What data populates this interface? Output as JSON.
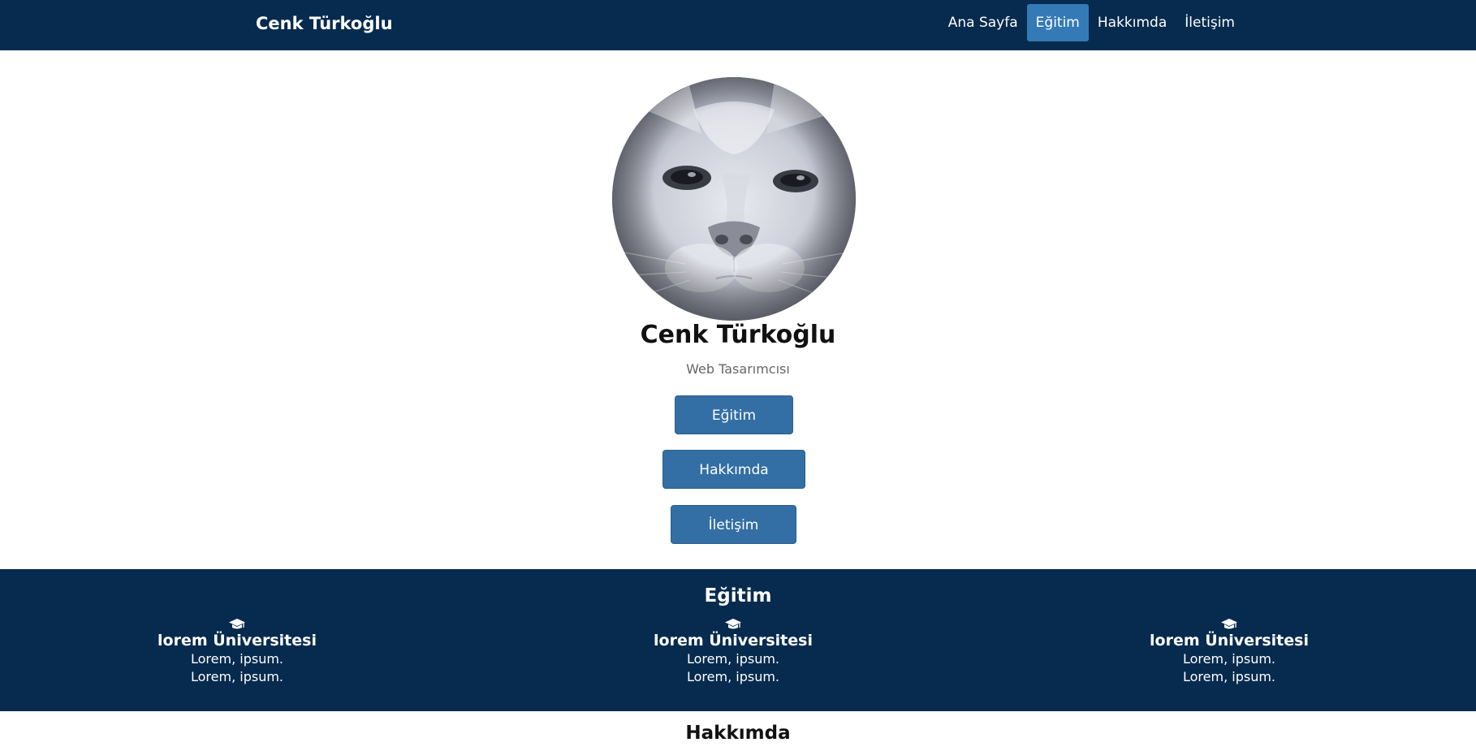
{
  "navbar": {
    "brand": "Cenk Türkoğlu",
    "links": [
      {
        "label": "Ana Sayfa",
        "active": false
      },
      {
        "label": "Eğitim",
        "active": true
      },
      {
        "label": "Hakkımda",
        "active": false
      },
      {
        "label": "İletişim",
        "active": false
      }
    ],
    "colors": {
      "background": "#072b4e",
      "active": "#337ab7"
    }
  },
  "hero": {
    "avatar_icon": "cat-photo",
    "name": "Cenk Türkoğlu",
    "subtitle": "Web Tasarımcısı",
    "buttons": {
      "egitim": "Eğitim",
      "hakkimda": "Hakkımda",
      "iletisim": "İletişim"
    },
    "button_color": "#336fa5"
  },
  "education": {
    "title": "Eğitim",
    "icon": "graduation-cap-icon",
    "items": [
      {
        "school": "lorem Üniversitesi",
        "line1": "Lorem, ipsum.",
        "line2": "Lorem, ipsum."
      },
      {
        "school": "lorem Üniversitesi",
        "line1": "Lorem, ipsum.",
        "line2": "Lorem, ipsum."
      },
      {
        "school": "lorem Üniversitesi",
        "line1": "Lorem, ipsum.",
        "line2": "Lorem, ipsum."
      }
    ]
  },
  "about": {
    "title": "Hakkımda"
  }
}
